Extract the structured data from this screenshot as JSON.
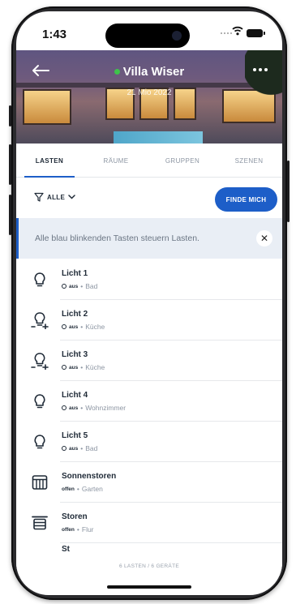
{
  "status_bar": {
    "time": "1:43"
  },
  "header": {
    "title": "Villa Wiser",
    "subtitle": "21 Mio 2022",
    "online_color": "#3ec44b"
  },
  "tabs": [
    {
      "label": "LASTEN",
      "active": true
    },
    {
      "label": "RÄUME",
      "active": false
    },
    {
      "label": "GRUPPEN",
      "active": false
    },
    {
      "label": "SZENEN",
      "active": false
    }
  ],
  "filter": {
    "label": "ALLE",
    "locate_button": "FINDE MICH"
  },
  "banner": {
    "text": "Alle blau blinkenden Tasten steuern Lasten.",
    "close_glyph": "✕"
  },
  "loads": [
    {
      "name": "Licht 1",
      "state": "aus",
      "room": "Bad",
      "icon": "bulb-icon"
    },
    {
      "name": "Licht 2",
      "state": "aus",
      "room": "Küche",
      "icon": "dimmer-bulb-icon"
    },
    {
      "name": "Licht 3",
      "state": "aus",
      "room": "Küche",
      "icon": "dimmer-bulb-icon"
    },
    {
      "name": "Licht 4",
      "state": "aus",
      "room": "Wohnzimmer",
      "icon": "bulb-icon"
    },
    {
      "name": "Licht 5",
      "state": "aus",
      "room": "Bad",
      "icon": "bulb-icon"
    },
    {
      "name": "Sonnenstoren",
      "state": "offen",
      "room": "Garten",
      "icon": "awning-icon"
    },
    {
      "name": "Storen",
      "state": "offen",
      "room": "Flur",
      "icon": "blind-icon"
    }
  ],
  "peek_item": "St",
  "footer": {
    "count": "6 LASTEN / 6 GERÄTE"
  },
  "colors": {
    "accent": "#1d5ec8",
    "text": "#1f2a37",
    "muted": "#8d96a3"
  }
}
